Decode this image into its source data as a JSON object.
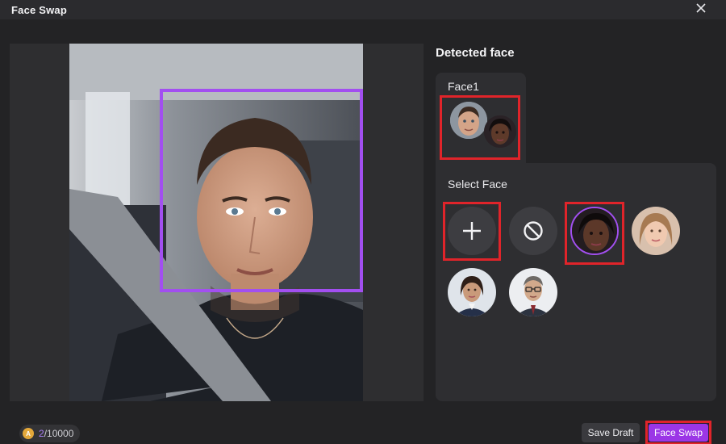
{
  "window": {
    "title": "Face Swap"
  },
  "detected": {
    "heading": "Detected face",
    "tab_label": "Face1"
  },
  "select": {
    "heading": "Select Face",
    "options": [
      "add-face",
      "no-face",
      "woman-dark-hair-selected",
      "woman-light-hair",
      "woman-business",
      "man-business-glasses"
    ]
  },
  "footer": {
    "credits_used": "2",
    "credits_total": "/10000",
    "save_draft_label": "Save Draft",
    "face_swap_label": "Face Swap"
  },
  "colors": {
    "accent": "#9b36e6",
    "face_box": "#a24ff0",
    "highlight": "#e0242a"
  }
}
